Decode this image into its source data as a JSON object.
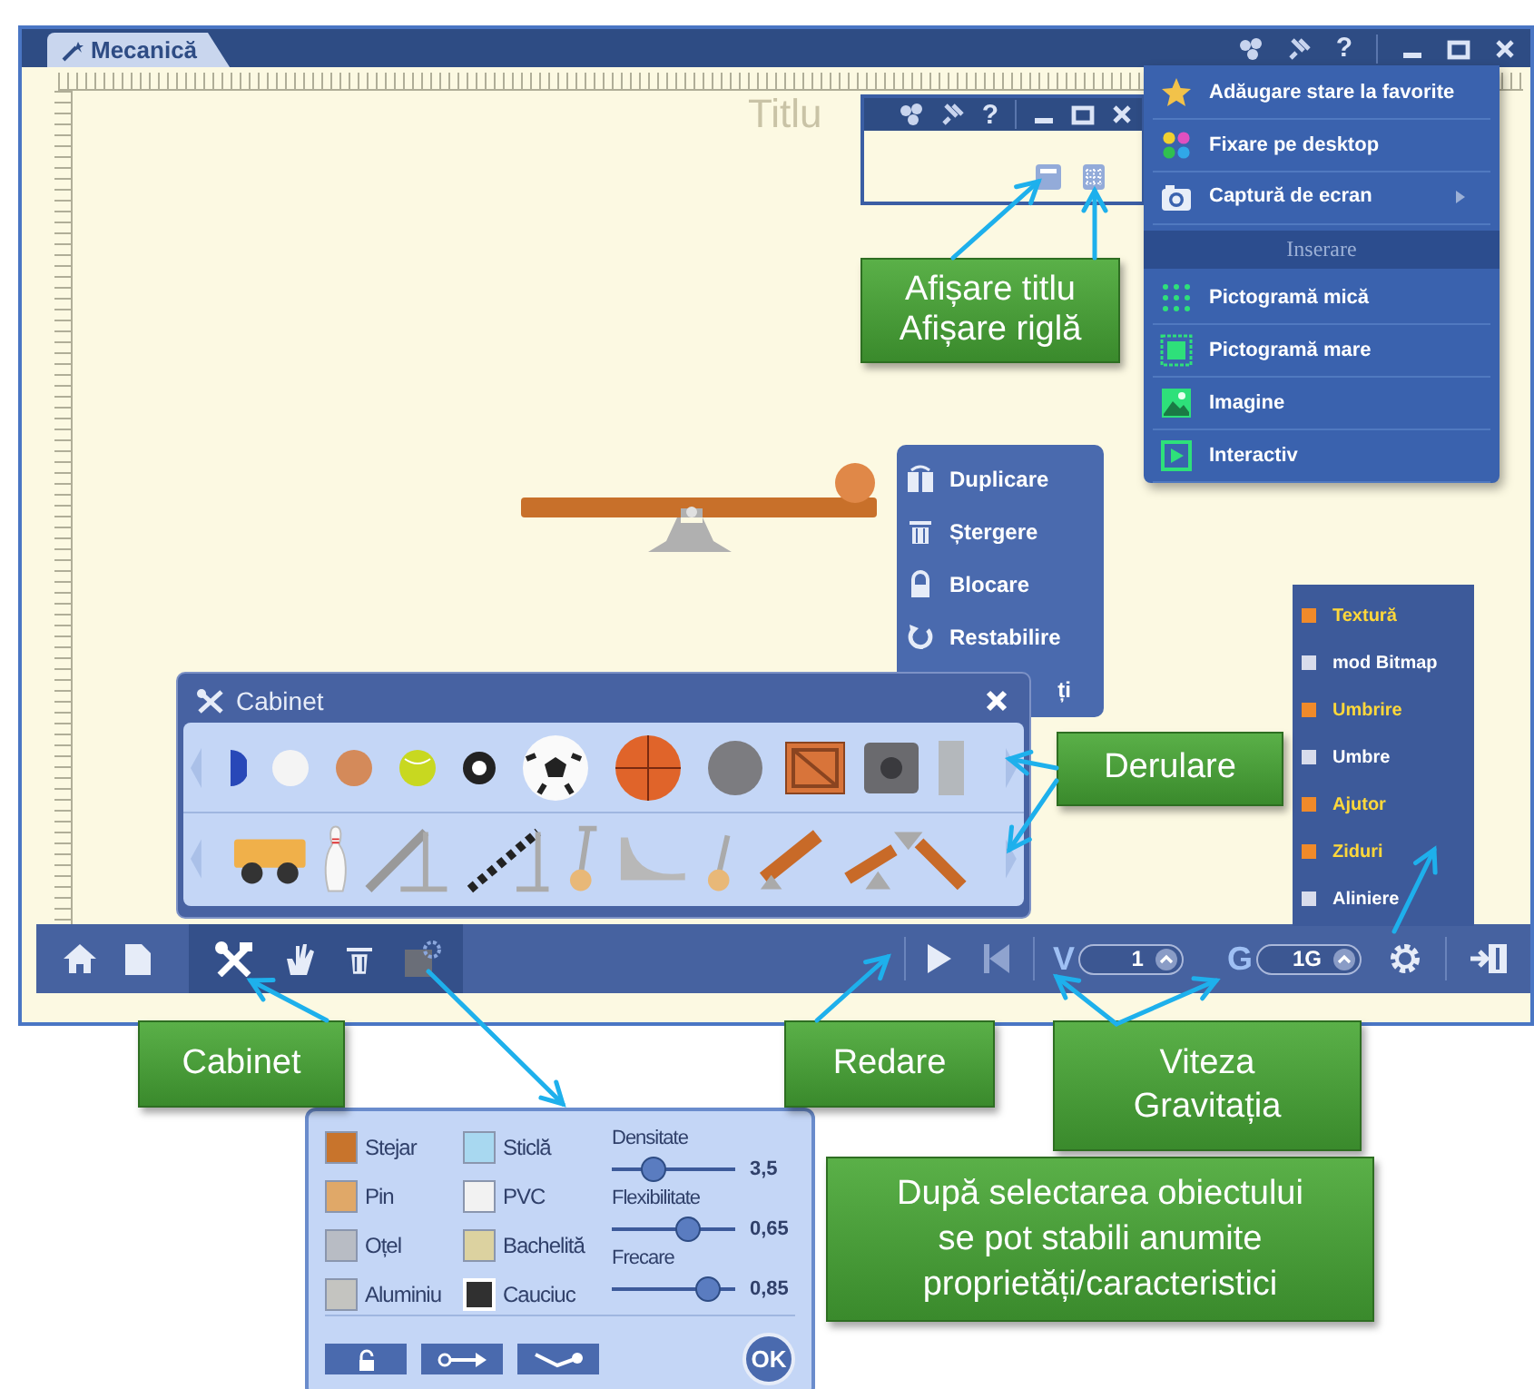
{
  "window": {
    "tab": "Mecanică",
    "help": "?"
  },
  "canvas": {
    "title": "Titlu"
  },
  "title_window": {
    "help": "?"
  },
  "menu": {
    "items": [
      {
        "kind": "item",
        "label": "Adăugare stare la favorite",
        "submenu": false
      },
      {
        "kind": "item",
        "label": "Fixare pe desktop",
        "submenu": false
      },
      {
        "kind": "item",
        "label": "Captură de ecran",
        "submenu": true
      },
      {
        "kind": "header",
        "label": "Inserare"
      },
      {
        "kind": "item",
        "label": "Pictogramă mică",
        "submenu": false
      },
      {
        "kind": "item",
        "label": "Pictogramă mare",
        "submenu": false
      },
      {
        "kind": "item",
        "label": "Imagine",
        "submenu": false
      },
      {
        "kind": "item",
        "label": "Interactiv",
        "submenu": false
      }
    ]
  },
  "context_menu": {
    "items": [
      "Duplicare",
      "Ștergere",
      "Blocare",
      "Restabilire",
      "ți"
    ]
  },
  "cabinet": {
    "title": "Cabinet"
  },
  "options": {
    "items": [
      {
        "label": "Textură",
        "checked": true
      },
      {
        "label": "mod Bitmap",
        "checked": false
      },
      {
        "label": "Umbrire",
        "checked": true
      },
      {
        "label": "Umbre",
        "checked": false
      },
      {
        "label": "Ajutor",
        "checked": true
      },
      {
        "label": "Ziduri",
        "checked": true
      },
      {
        "label": "Aliniere",
        "checked": false
      }
    ]
  },
  "toolbar": {
    "speed_label": "V",
    "speed": "1",
    "gravity_label": "G",
    "gravity": "1G"
  },
  "properties": {
    "materials": [
      {
        "label": "Stejar",
        "color": "#c8742c",
        "selected": false
      },
      {
        "label": "Sticlă",
        "color": "#a8d8f0",
        "selected": false
      },
      {
        "label": "Pin",
        "color": "#e0a868",
        "selected": false
      },
      {
        "label": "PVC",
        "color": "#f2f2f2",
        "selected": false
      },
      {
        "label": "Oțel",
        "color": "#b8bcc4",
        "selected": false
      },
      {
        "label": "Bachelită",
        "color": "#dcd2a0",
        "selected": false
      },
      {
        "label": "Aluminiu",
        "color": "#c4c4c0",
        "selected": false
      },
      {
        "label": "Cauciuc",
        "color": "#303030",
        "selected": true
      }
    ],
    "sliders": [
      {
        "label": "Densitate",
        "level": 0.3,
        "reading": "3,5"
      },
      {
        "label": "Flexibilitate",
        "level": 0.65,
        "reading": "0,65"
      },
      {
        "label": "Frecare",
        "level": 0.85,
        "reading": "0,85"
      }
    ],
    "ok": "OK"
  },
  "callouts": [
    {
      "lines": [
        "Afișare titlu",
        "Afișare riglă"
      ]
    },
    {
      "lines": [
        "Derulare"
      ]
    },
    {
      "lines": [
        "Cabinet"
      ]
    },
    {
      "lines": [
        "Redare"
      ]
    },
    {
      "lines": [
        "Viteza",
        "Gravitația"
      ]
    },
    {
      "lines": [
        "După selectarea obiectului",
        "se pot stabili anumite",
        "proprietăți/caracteristici"
      ]
    }
  ]
}
